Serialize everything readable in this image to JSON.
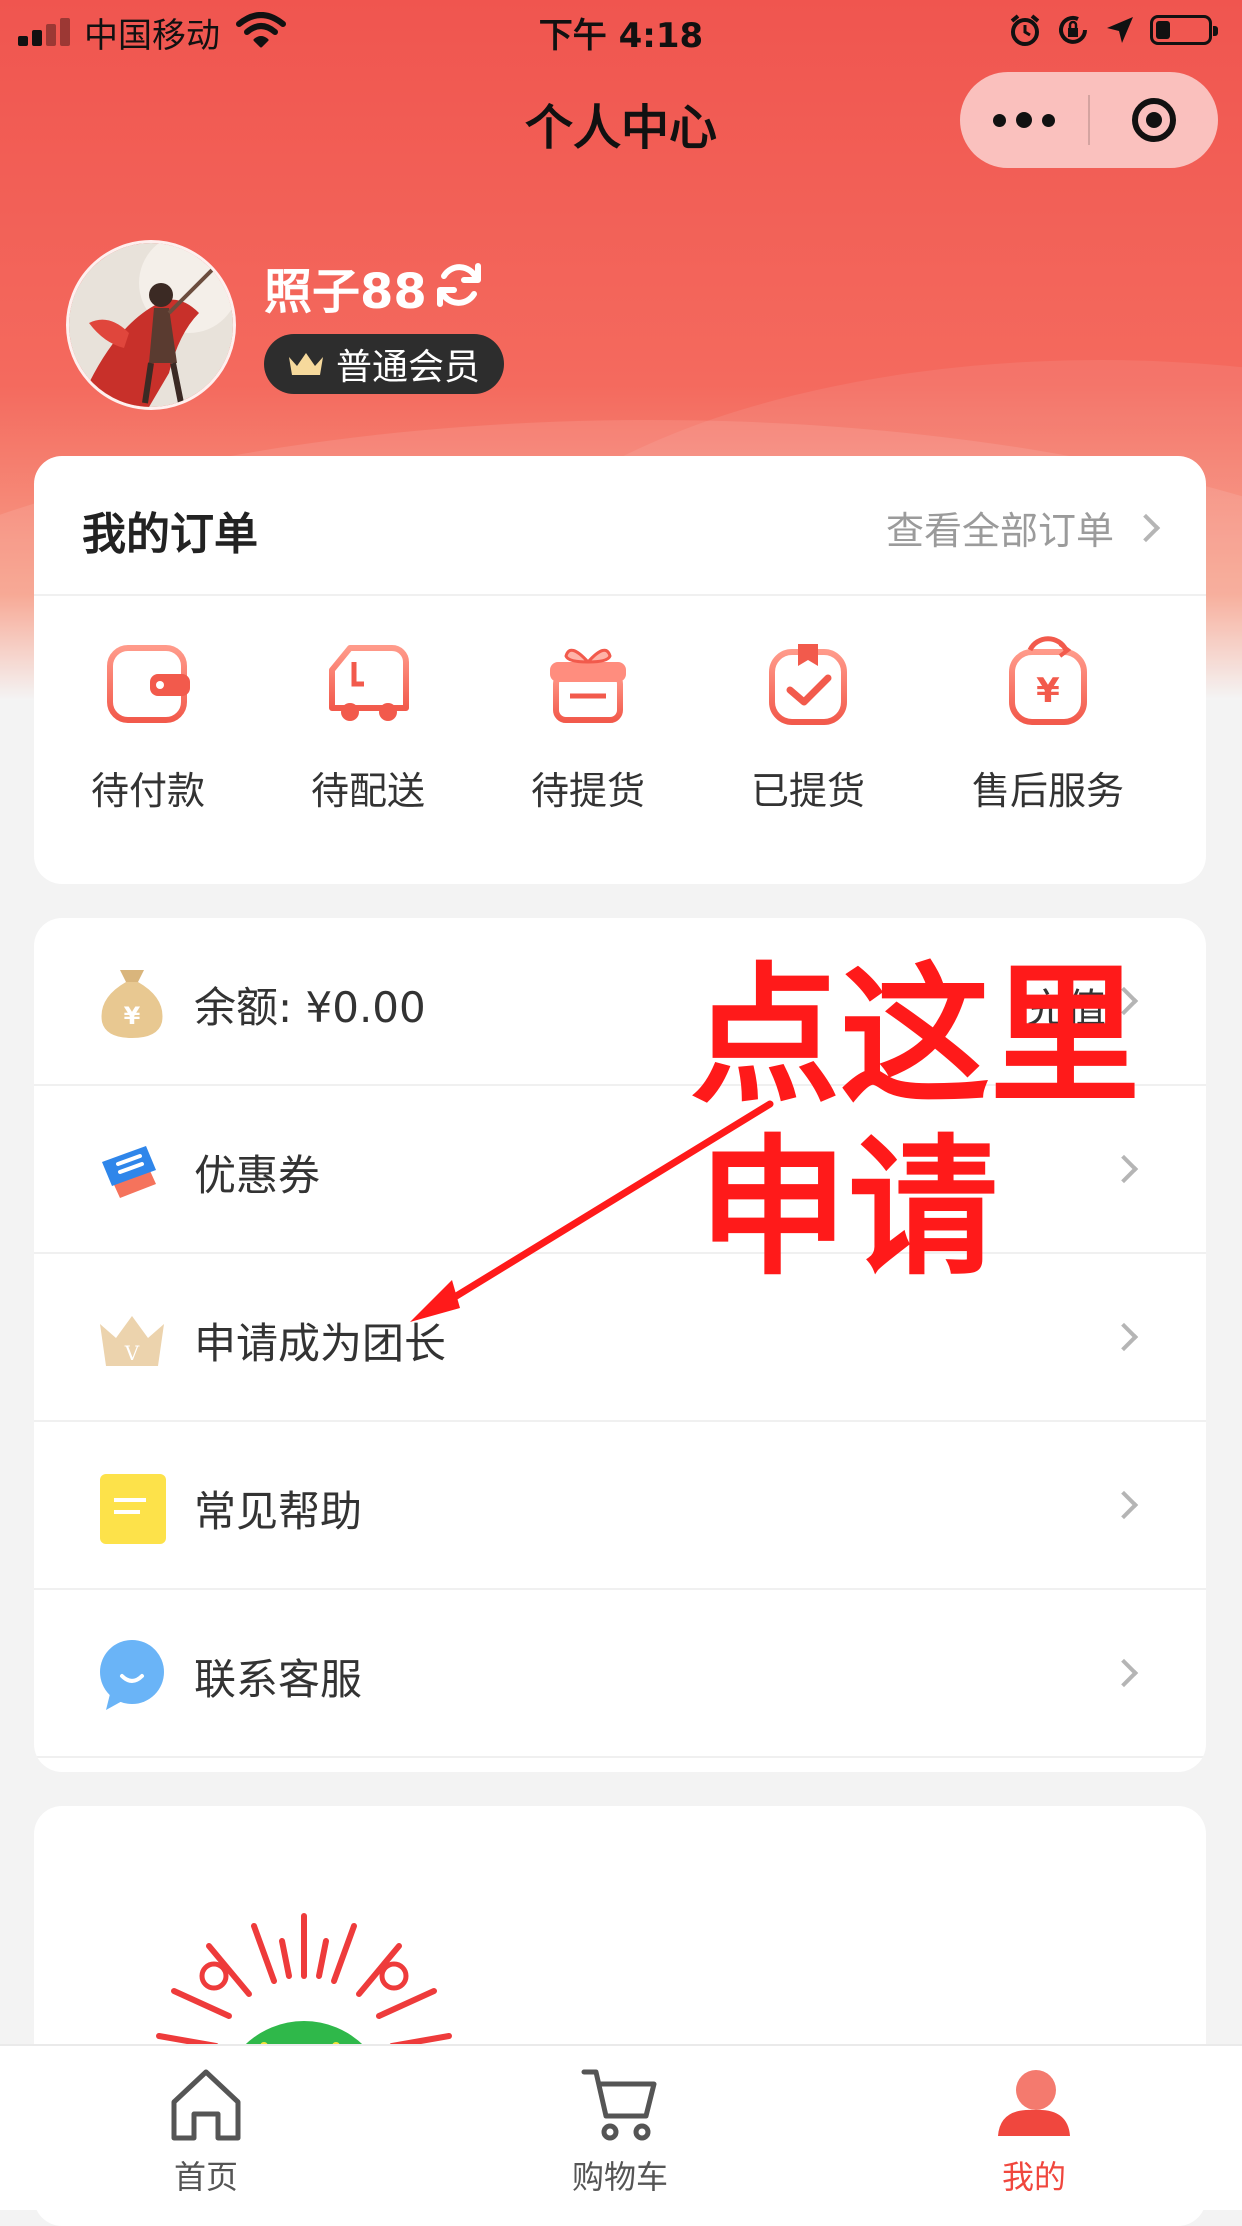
{
  "status_bar": {
    "carrier": "中国移动",
    "time": "下午 4:18"
  },
  "nav": {
    "title": "个人中心"
  },
  "profile": {
    "username": "照子88",
    "member_level": "普通会员"
  },
  "orders": {
    "title": "我的订单",
    "view_all": "查看全部订单",
    "items": [
      {
        "label": "待付款",
        "icon": "wallet-icon"
      },
      {
        "label": "待配送",
        "icon": "delivery-truck-icon"
      },
      {
        "label": "待提货",
        "icon": "gift-box-icon"
      },
      {
        "label": "已提货",
        "icon": "picked-up-check-icon"
      },
      {
        "label": "售后服务",
        "icon": "after-sales-yen-icon"
      }
    ]
  },
  "menu": {
    "items": [
      {
        "label": "余额: ¥0.00",
        "right": "充值",
        "icon": "money-bag-icon"
      },
      {
        "label": "优惠券",
        "right": "",
        "icon": "coupon-icon"
      },
      {
        "label": "申请成为团长",
        "right": "",
        "icon": "crown-icon"
      },
      {
        "label": "常见帮助",
        "right": "",
        "icon": "help-note-icon"
      },
      {
        "label": "联系客服",
        "right": "",
        "icon": "customer-service-bubble-icon"
      }
    ]
  },
  "annotation": {
    "line1": "点这里",
    "line2": "申请"
  },
  "tabbar": {
    "items": [
      {
        "label": "首页",
        "icon": "home-icon",
        "active": false
      },
      {
        "label": "购物车",
        "icon": "cart-icon",
        "active": false
      },
      {
        "label": "我的",
        "icon": "user-icon",
        "active": true
      }
    ]
  },
  "colors": {
    "brand_red": "#f0554f",
    "annotation_red": "#ff1a1a",
    "active_tab": "#f0473e"
  }
}
